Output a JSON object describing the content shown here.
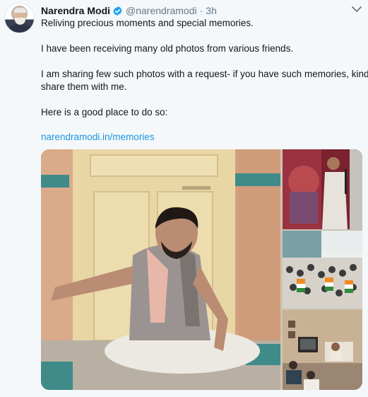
{
  "tweet": {
    "author_name": "Narendra Modi",
    "handle": "@narendramodi",
    "separator": "·",
    "timestamp": "3h",
    "lines": [
      "Reliving precious moments and special memories.",
      "I have been receiving many old photos from various friends.",
      "I am sharing few such photos with a request- if you have such memories, kindly",
      "share them with me.",
      "Here is a good place to do so:"
    ],
    "link": "narendramodi.in/memories"
  },
  "icons": {
    "verified": "verified-badge-icon",
    "more": "chevron-down-icon"
  },
  "colors": {
    "background": "#f5f8fa",
    "link": "#1b95e0",
    "secondary_text": "#657786",
    "verified": "#1da1f2"
  },
  "media": {
    "photo_count": 4
  }
}
